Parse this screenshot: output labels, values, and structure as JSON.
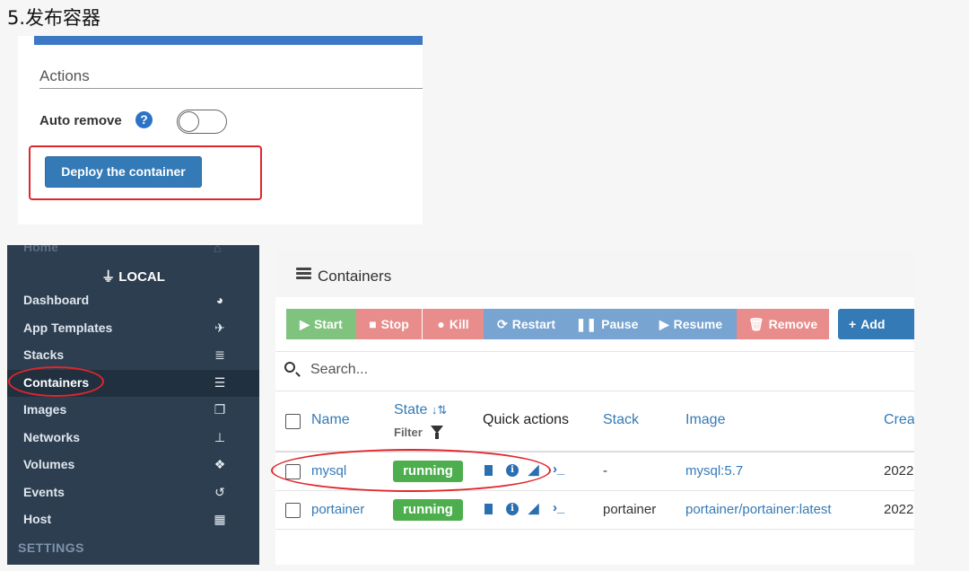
{
  "step_title": "5.发布容器",
  "actions_panel": {
    "section_title": "Actions",
    "auto_remove_label": "Auto remove",
    "help_icon": "?",
    "deploy_button": "Deploy the container"
  },
  "sidebar": {
    "home_label": "Home",
    "endpoint_label": "LOCAL",
    "endpoint_icon": "plug-icon",
    "items": [
      {
        "label": "Dashboard",
        "icon": "tachometer-icon",
        "glyph": "◕"
      },
      {
        "label": "App Templates",
        "icon": "rocket-icon",
        "glyph": "✈"
      },
      {
        "label": "Stacks",
        "icon": "th-list-icon",
        "glyph": "≣"
      },
      {
        "label": "Containers",
        "icon": "server-icon",
        "glyph": "☰",
        "active": true
      },
      {
        "label": "Images",
        "icon": "clone-icon",
        "glyph": "❐"
      },
      {
        "label": "Networks",
        "icon": "sitemap-icon",
        "glyph": "⊥"
      },
      {
        "label": "Volumes",
        "icon": "cubes-icon",
        "glyph": "❖"
      },
      {
        "label": "Events",
        "icon": "history-icon",
        "glyph": "↺"
      },
      {
        "label": "Host",
        "icon": "th-icon",
        "glyph": "▦"
      }
    ],
    "settings_label": "SETTINGS"
  },
  "containers": {
    "title": "Containers",
    "buttons": {
      "start": "Start",
      "stop": "Stop",
      "kill": "Kill",
      "restart": "Restart",
      "pause": "Pause",
      "resume": "Resume",
      "remove": "Remove",
      "add": "Add container"
    },
    "search_placeholder": "Search...",
    "columns": {
      "name": "Name",
      "state": "State",
      "state_sort": "↓⇅",
      "filter": "Filter",
      "quick_actions": "Quick actions",
      "stack": "Stack",
      "image": "Image",
      "created": "Created"
    },
    "rows": [
      {
        "name": "mysql",
        "state": "running",
        "stack": "-",
        "image": "mysql:5.7",
        "created": "2022"
      },
      {
        "name": "portainer",
        "state": "running",
        "stack": "portainer",
        "image": "portainer/portainer:latest",
        "created": "2022"
      }
    ],
    "quick_action_console": "›_"
  },
  "colors": {
    "highlight_red": "#e0262b",
    "primary_blue": "#337ab7",
    "sidebar_bg": "#2d3e50",
    "running_green": "#4cae4c"
  }
}
